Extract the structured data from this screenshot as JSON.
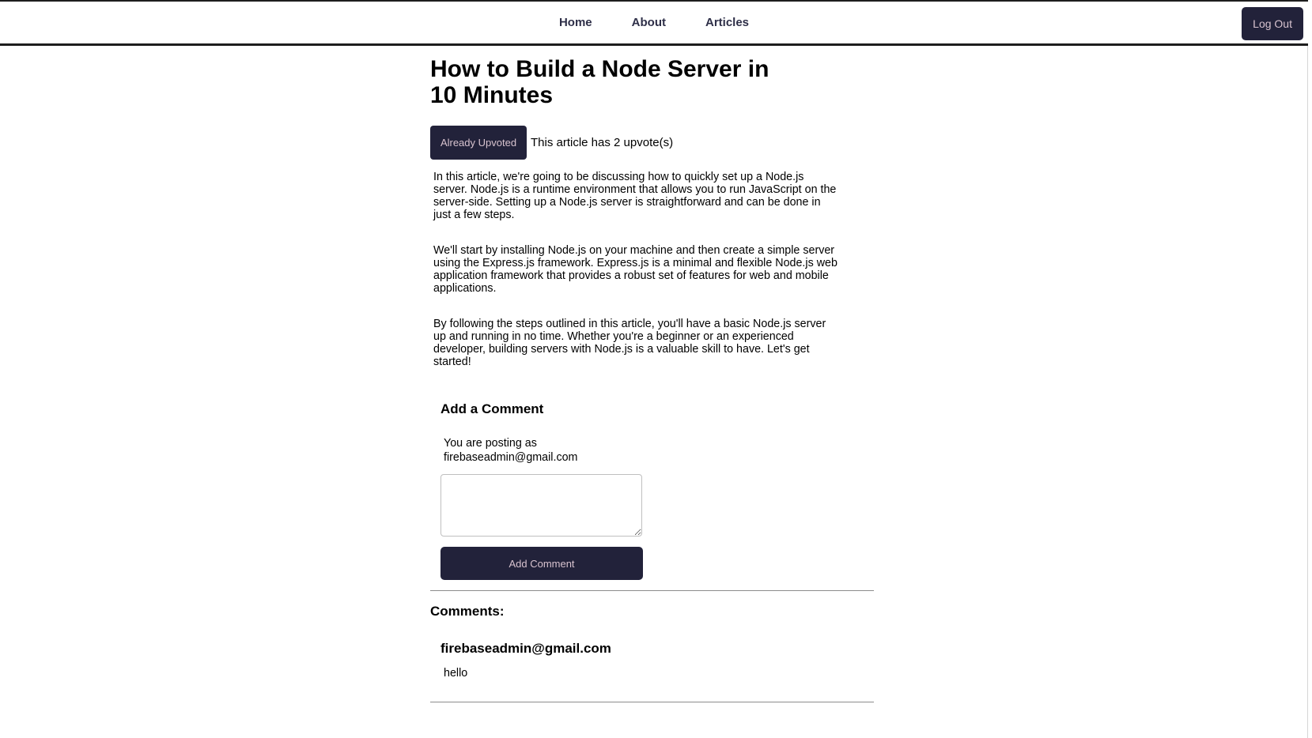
{
  "nav": {
    "links": [
      {
        "label": "Home"
      },
      {
        "label": "About"
      },
      {
        "label": "Articles"
      }
    ],
    "logout_label": "Log Out"
  },
  "article": {
    "title": "How to Build a Node Server in 10 Minutes",
    "upvote_button_label": "Already Upvoted",
    "upvote_text": "This article has 2 upvote(s)",
    "upvote_count": 2,
    "paragraphs": [
      "In this article, we're going to be discussing how to quickly set up a Node.js server. Node.js is a runtime environment that allows you to run JavaScript on the server-side. Setting up a Node.js server is straightforward and can be done in just a few steps.",
      "We'll start by installing Node.js on your machine and then create a simple server using the Express.js framework. Express.js is a minimal and flexible Node.js web application framework that provides a robust set of features for web and mobile applications.",
      "By following the steps outlined in this article, you'll have a basic Node.js server up and running in no time. Whether you're a beginner or an experienced developer, building servers with Node.js is a valuable skill to have. Let's get started!"
    ]
  },
  "comment_form": {
    "title": "Add a Comment",
    "posting_as": "You are posting as firebaseadmin@gmail.com",
    "textarea_value": "",
    "submit_label": "Add Comment"
  },
  "comments": {
    "heading": "Comments:",
    "items": [
      {
        "author": "firebaseadmin@gmail.com",
        "text": "hello"
      }
    ]
  },
  "colors": {
    "button_bg": "#22223a",
    "button_text": "#d8c3cf",
    "nav_link": "#2e2f48",
    "divider": "#8c8c8c"
  }
}
